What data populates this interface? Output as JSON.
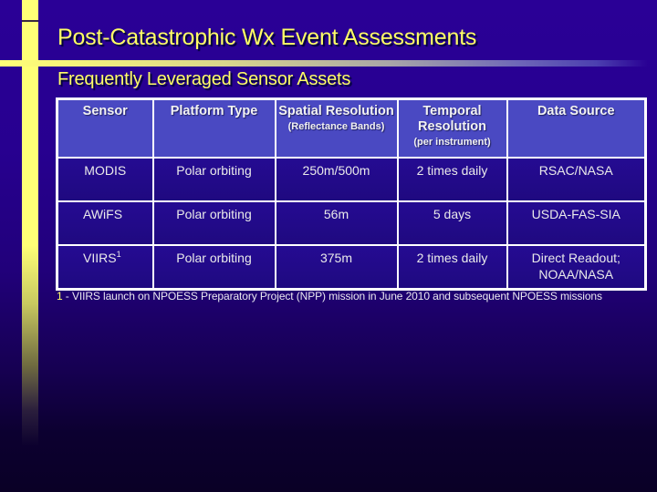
{
  "slide": {
    "title": "Post-Catastrophic Wx Event Assessments",
    "subtitle": "Frequently Leveraged Sensor Assets"
  },
  "colors": {
    "accent_yellow": "#ffff66",
    "background_top": "#2a0096",
    "header_cell": "#4a49c2",
    "data_cell": "#1f0a88"
  },
  "table": {
    "columns": [
      {
        "label": "Sensor",
        "sublabel": ""
      },
      {
        "label": "Platform Type",
        "sublabel": ""
      },
      {
        "label": "Spatial Resolution",
        "sublabel": "(Reflectance Bands)"
      },
      {
        "label": "Temporal Resolution",
        "sublabel": "(per instrument)"
      },
      {
        "label": "Data Source",
        "sublabel": ""
      }
    ],
    "rows": [
      {
        "sensor": "MODIS",
        "sensor_sup": "",
        "platform": "Polar orbiting",
        "spatial": "250m/500m",
        "temporal": "2 times daily",
        "source": "RSAC/NASA",
        "source_line2": ""
      },
      {
        "sensor": "AWiFS",
        "sensor_sup": "",
        "platform": "Polar orbiting",
        "spatial": "56m",
        "temporal": "5 days",
        "source": "USDA-FAS-SIA",
        "source_line2": ""
      },
      {
        "sensor": "VIIRS",
        "sensor_sup": "1",
        "platform": "Polar orbiting",
        "spatial": "375m",
        "temporal": "2 times daily",
        "source": "Direct Readout;",
        "source_line2": "NOAA/NASA"
      }
    ]
  },
  "footnote": {
    "number": "1",
    "text": " - VIIRS launch on NPOESS Preparatory Project (NPP) mission in June 2010 and subsequent NPOESS missions"
  }
}
